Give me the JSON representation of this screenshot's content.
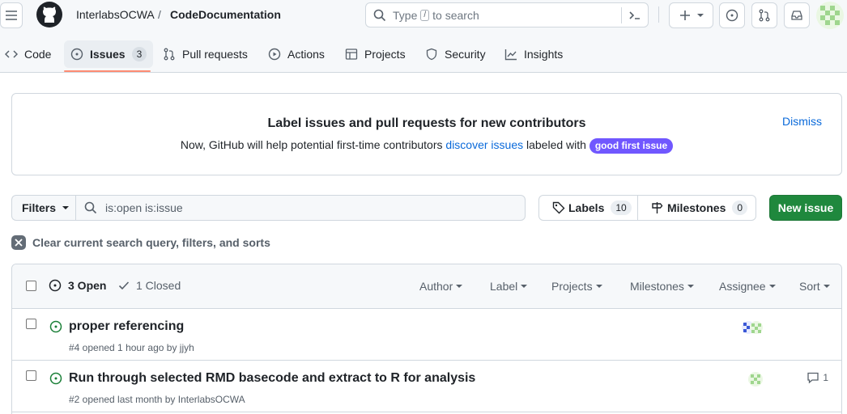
{
  "header": {
    "owner": "InterlabsOCWA",
    "separator": "/",
    "repo": "CodeDocumentation",
    "search_prefix": "Type",
    "search_key": "/",
    "search_suffix": "to search"
  },
  "tabs": [
    {
      "label": "Code"
    },
    {
      "label": "Issues",
      "count": "3"
    },
    {
      "label": "Pull requests"
    },
    {
      "label": "Actions"
    },
    {
      "label": "Projects"
    },
    {
      "label": "Security"
    },
    {
      "label": "Insights"
    }
  ],
  "banner": {
    "title": "Label issues and pull requests for new contributors",
    "text_before": "Now, GitHub will help potential first-time contributors",
    "link": "discover issues",
    "text_after": "labeled with",
    "label": "good first issue",
    "dismiss": "Dismiss"
  },
  "filters": {
    "button": "Filters",
    "query": "is:open is:issue",
    "labels": "Labels",
    "labels_count": "10",
    "milestones": "Milestones",
    "milestones_count": "0",
    "new_issue": "New issue",
    "clear": "Clear current search query, filters, and sorts"
  },
  "list": {
    "open": "3 Open",
    "closed": "1 Closed",
    "sorts": [
      "Author",
      "Label",
      "Projects",
      "Milestones",
      "Assignee",
      "Sort"
    ]
  },
  "issues": [
    {
      "title": "proper referencing",
      "meta": "#4 opened 1 hour ago by jjyh",
      "comments": ""
    },
    {
      "title": "Run through selected RMD basecode and extract to R for analysis",
      "meta": "#2 opened last month by InterlabsOCWA",
      "comments": "1"
    }
  ],
  "colors": {
    "accent_green": "#1f883d",
    "link_blue": "#0969da",
    "good_first_issue": "#7057ff",
    "open_icon": "#1a7f37",
    "tab_underline": "#fd8c73"
  }
}
